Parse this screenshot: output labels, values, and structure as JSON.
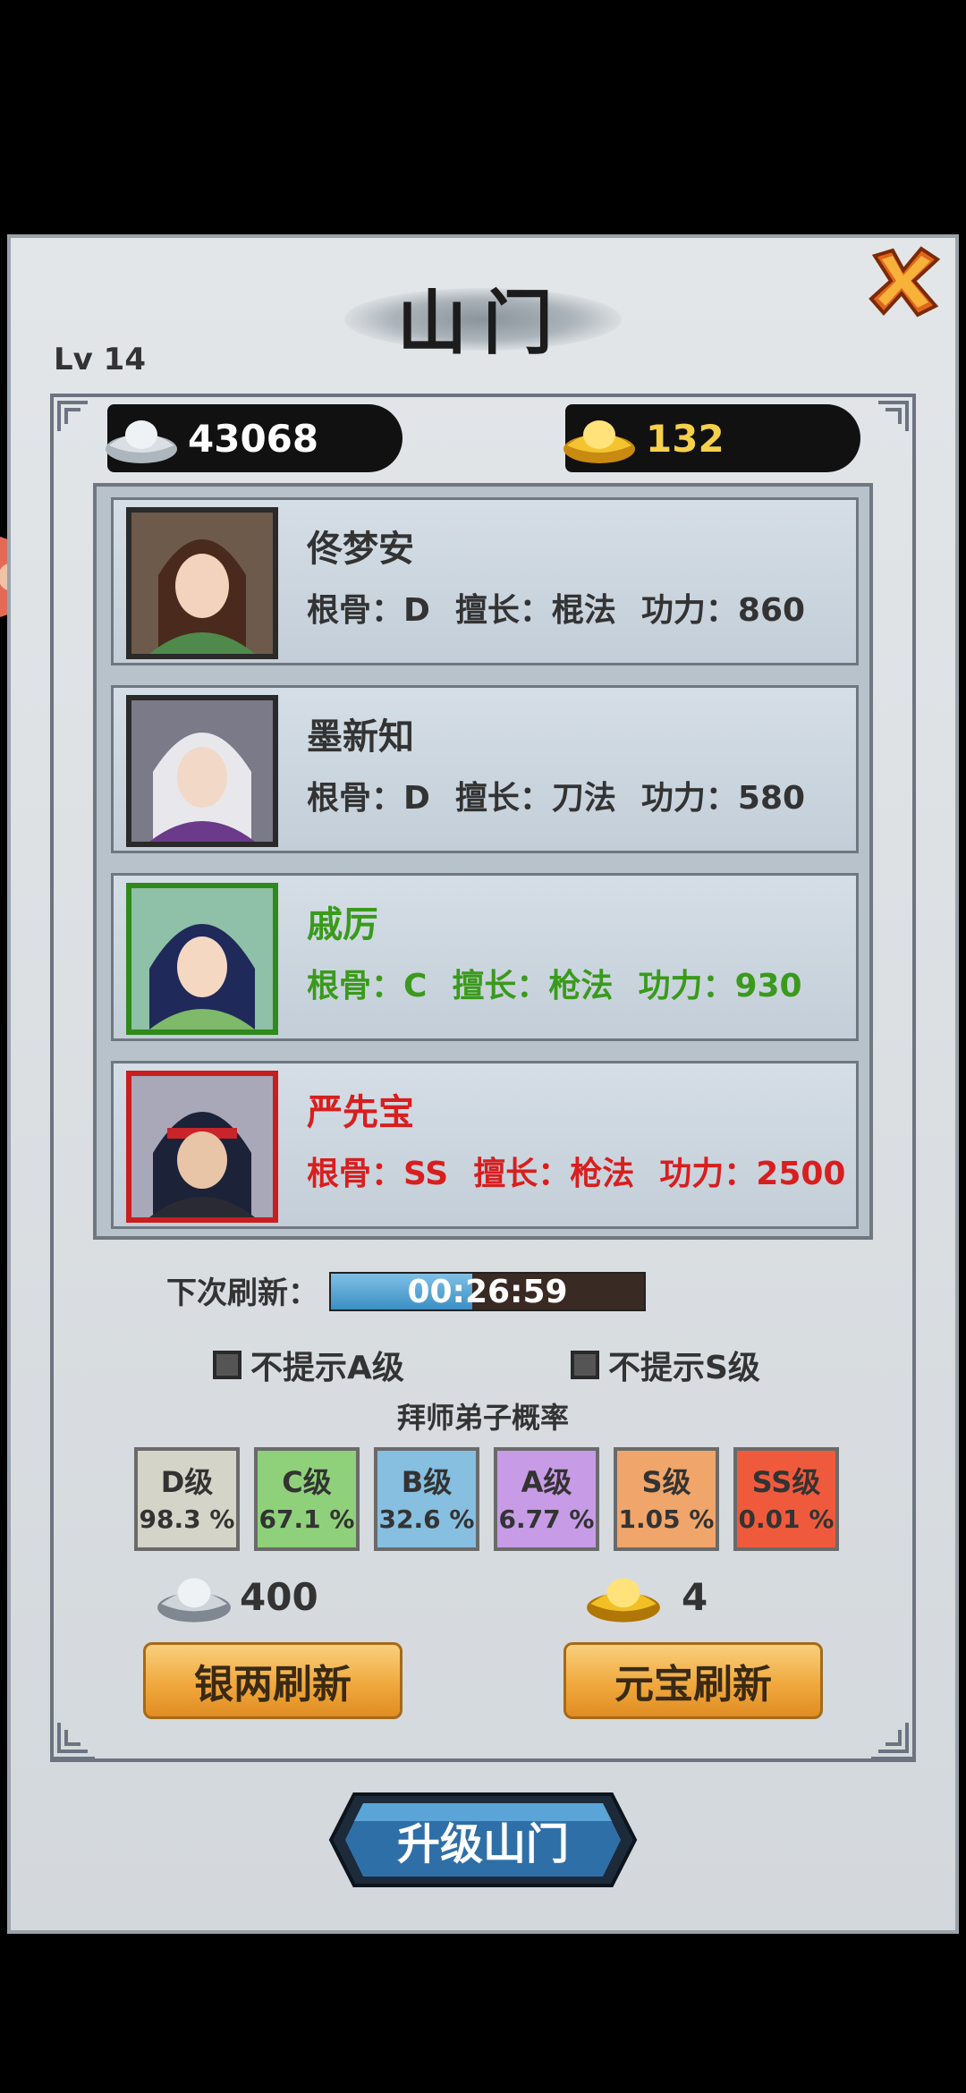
{
  "title": "山门",
  "level": "Lv 14",
  "currency": {
    "silver": "43068",
    "gold": "132"
  },
  "disciples": [
    {
      "name": "佟梦安",
      "rootbone": "根骨：D",
      "skill": "擅长：棍法",
      "power": "功力：860",
      "color": "#333333",
      "frame": "#2a2a2a"
    },
    {
      "name": "墨新知",
      "rootbone": "根骨：D",
      "skill": "擅长：刀法",
      "power": "功力：580",
      "color": "#333333",
      "frame": "#2a2a2a"
    },
    {
      "name": "戚厉",
      "rootbone": "根骨：C",
      "skill": "擅长：枪法",
      "power": "功力：930",
      "color": "#3a9a1c",
      "frame": "#2f8a1a"
    },
    {
      "name": "严先宝",
      "rootbone": "根骨：SS",
      "skill": "擅长：枪法",
      "power": "功力：2500",
      "color": "#d81e1e",
      "frame": "#c81e1e"
    }
  ],
  "refresh": {
    "label": "下次刷新：",
    "timer": "00:26:59",
    "progress": 0.45
  },
  "toggles": {
    "hide_a": "不提示A级",
    "hide_s": "不提示S级"
  },
  "probability": {
    "title": "拜师弟子概率",
    "grades": [
      {
        "name": "D级",
        "value": "98.3 %",
        "color": "#d5d4c8"
      },
      {
        "name": "C级",
        "value": "67.1 %",
        "color": "#8fd17a"
      },
      {
        "name": "B级",
        "value": "32.6 %",
        "color": "#86bfe0"
      },
      {
        "name": "A级",
        "value": "6.77 %",
        "color": "#c79be6"
      },
      {
        "name": "S级",
        "value": "1.05 %",
        "color": "#f0a56a"
      },
      {
        "name": "SS级",
        "value": "0.01 %",
        "color": "#f05a3c"
      }
    ]
  },
  "costs": {
    "silver": "400",
    "gold": "4"
  },
  "buttons": {
    "silver_refresh": "银两刷新",
    "gold_refresh": "元宝刷新",
    "upgrade": "升级山门"
  }
}
